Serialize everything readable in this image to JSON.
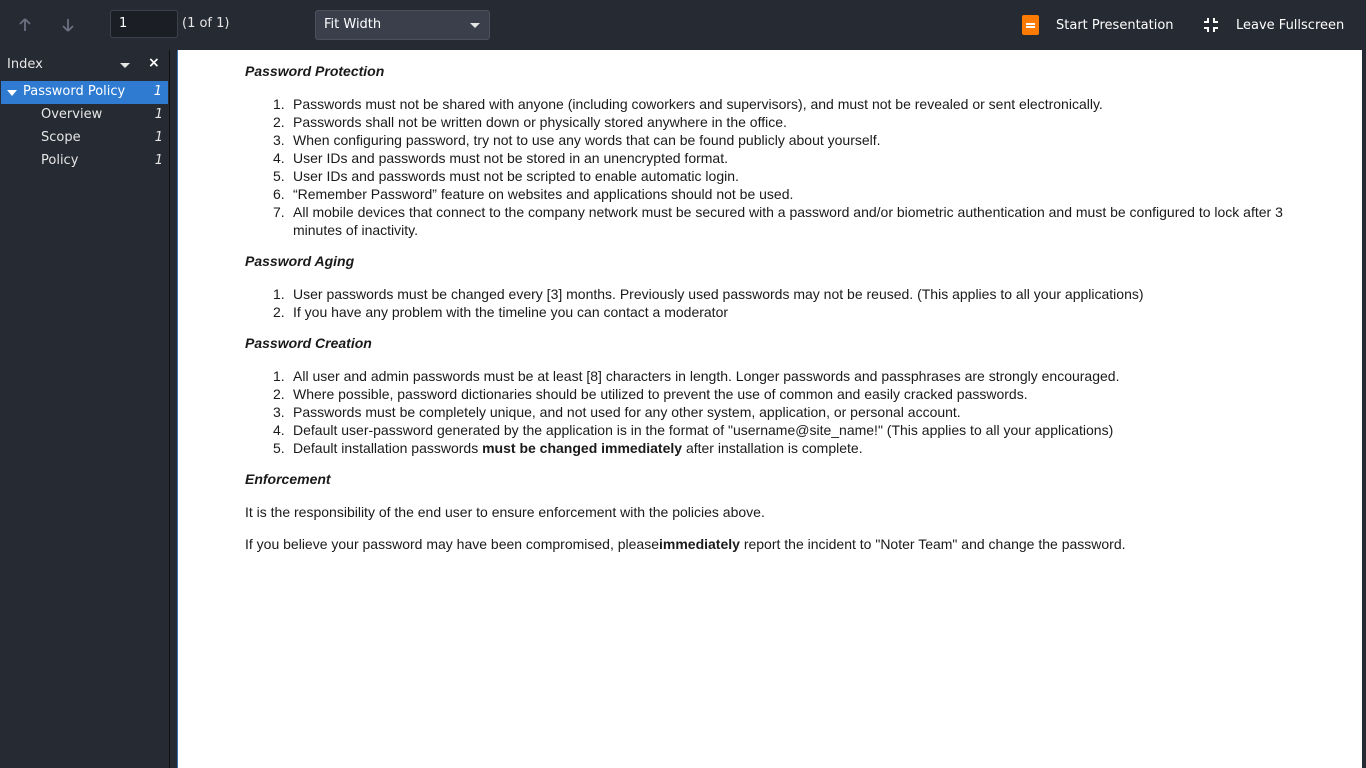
{
  "toolbar": {
    "page_value": "1",
    "page_count": "(1 of 1)",
    "zoom": "Fit Width",
    "present_label": "Start Presentation",
    "fullscreen_label": "Leave Fullscreen"
  },
  "sidebar": {
    "title": "Index",
    "close": "×",
    "items": [
      {
        "label": "Password Policy",
        "page": "1"
      },
      {
        "label": "Overview",
        "page": "1"
      },
      {
        "label": "Scope",
        "page": "1"
      },
      {
        "label": "Policy",
        "page": "1"
      }
    ]
  },
  "document": {
    "sections": [
      {
        "heading": "Password Protection",
        "items": [
          "Passwords must not be shared with anyone (including coworkers and supervisors), and must not be revealed or sent electronically.",
          "Passwords shall not be written down or physically stored anywhere in the office.",
          "When configuring password, try not to use any words that can be found publicly about yourself.",
          "User IDs and passwords must not be stored in an unencrypted format.",
          "User IDs and passwords must not be scripted to enable automatic login.",
          "“Remember Password” feature on websites and applications should not be used.",
          "All mobile devices that connect to the company network must be secured with a password and/or biometric authentication and must be configured to lock after 3 minutes of inactivity."
        ]
      },
      {
        "heading": "Password Aging",
        "items": [
          "User passwords must be changed every [3] months. Previously used passwords may not be reused. (This applies to all your applications)",
          "If you have any problem with the timeline you can contact a moderator"
        ]
      },
      {
        "heading": "Password Creation",
        "items": [
          "All user and admin passwords must be at least [8] characters in length. Longer passwords and passphrases are strongly encouraged.",
          "Where possible, password dictionaries should be utilized to prevent the use of common and easily cracked passwords.",
          "Passwords must be completely unique, and not used for any other system, application, or personal account.",
          "Default user-password generated by the application is in the format of \"username@site_name!\" (This applies to all your applications)"
        ],
        "item5_pre": "Default installation passwords ",
        "item5_bold": "must be changed immediately",
        "item5_post": " after installation is complete."
      },
      {
        "heading": "Enforcement",
        "para1": "It is the responsibility of the end user to ensure enforcement with the policies above.",
        "para2_pre": "If you believe your password may have been compromised, please",
        "para2_bold": "immediately",
        "para2_post": " report the incident to \"Noter Team\" and change the password."
      }
    ]
  }
}
